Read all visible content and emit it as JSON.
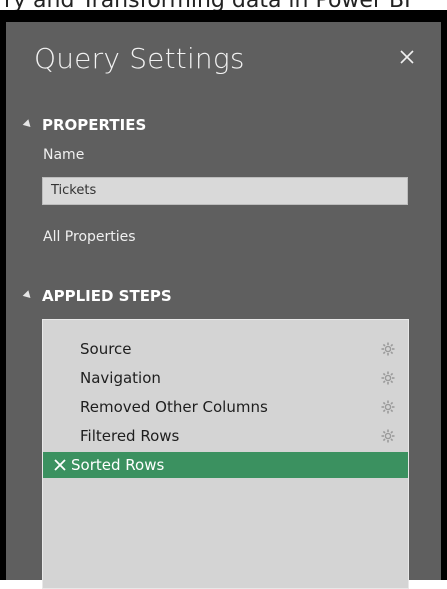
{
  "top_fragment": "ry and Transforming data in Power BI",
  "panel": {
    "title": "Query Settings",
    "close_icon": "close-icon"
  },
  "properties": {
    "header": "PROPERTIES",
    "name_label": "Name",
    "name_value": "Tickets",
    "all_properties_link": "All Properties"
  },
  "applied_steps": {
    "header": "APPLIED STEPS",
    "steps": [
      {
        "label": "Source",
        "icon": "gear-icon",
        "selected": false
      },
      {
        "label": "Navigation",
        "icon": "gear-icon",
        "selected": false
      },
      {
        "label": "Removed Other Columns",
        "icon": "gear-icon",
        "selected": false
      },
      {
        "label": "Filtered Rows",
        "icon": "gear-icon",
        "selected": false
      },
      {
        "label": "Sorted Rows",
        "icon": "delete-step-icon",
        "selected": true
      }
    ]
  },
  "colors": {
    "panel_bg": "#5f5f5f",
    "selected_step": "#3b9160",
    "steps_bg": "#d4d4d4"
  }
}
